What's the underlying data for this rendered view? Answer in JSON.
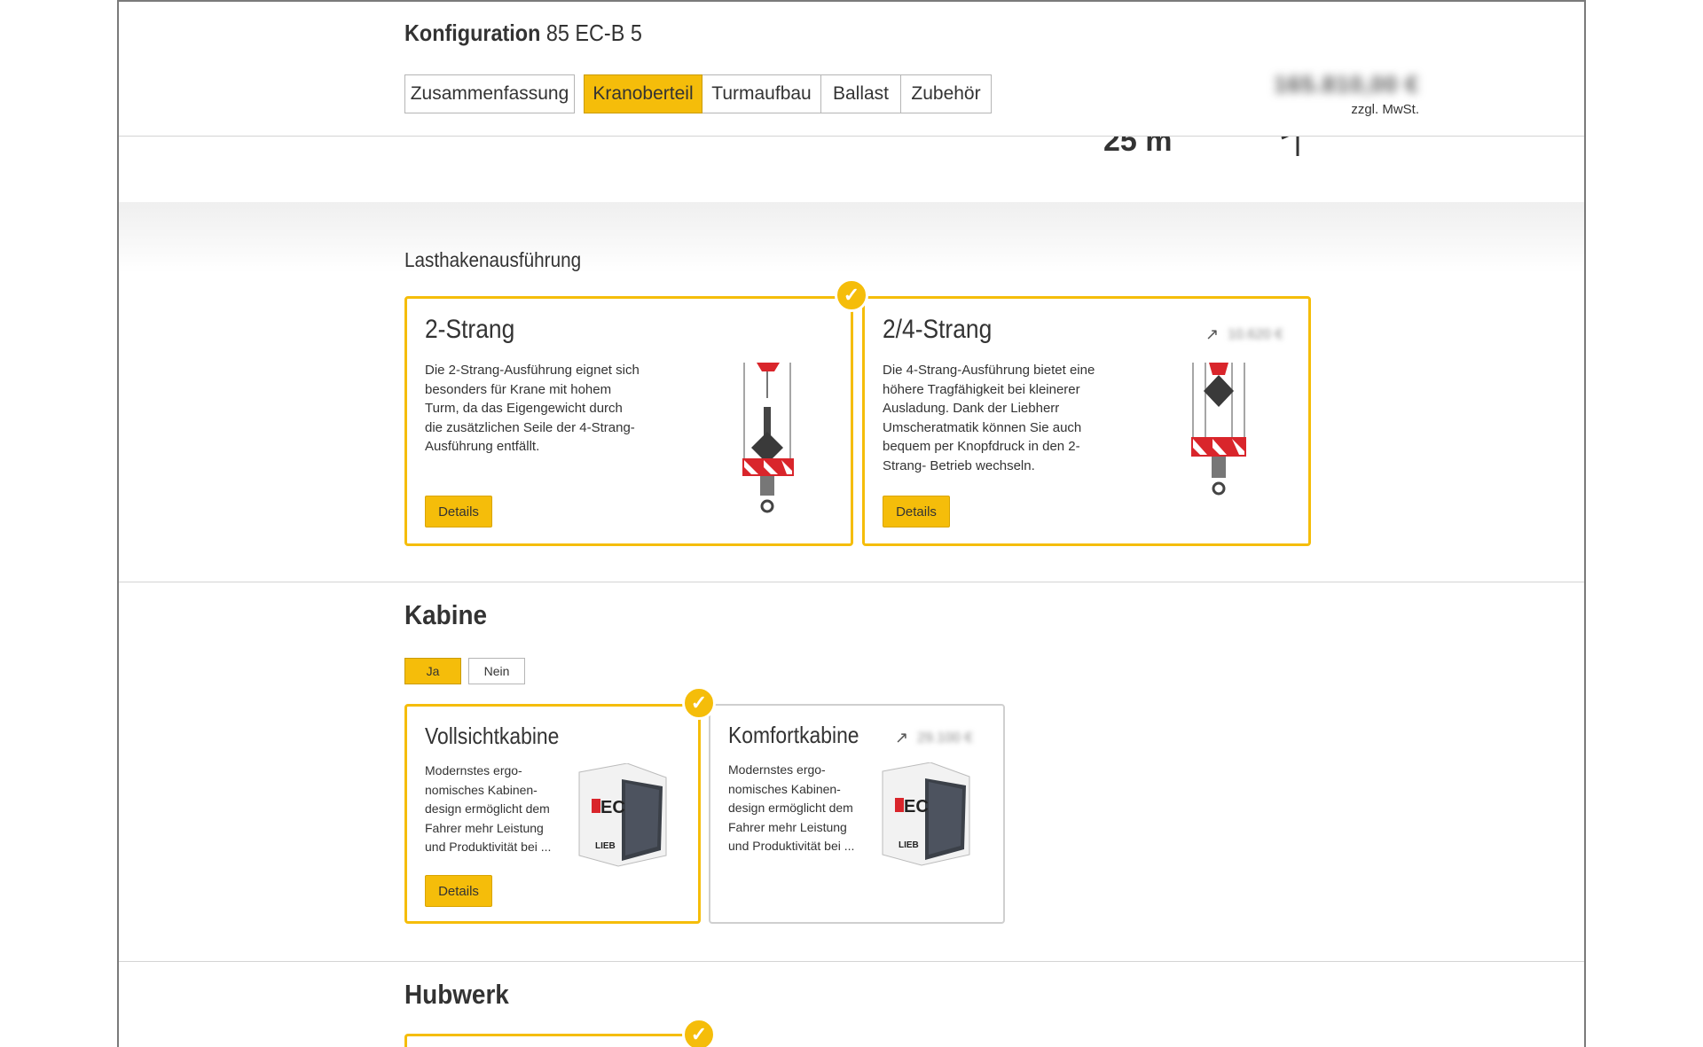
{
  "header": {
    "title_bold": "Konfiguration",
    "title_model": "85 EC-B 5",
    "tabs": [
      "Zusammenfassung",
      "Kranoberteil",
      "Turmaufbau",
      "Ballast",
      "Zubehör"
    ],
    "active_tab": "Kranoberteil",
    "price_blurred": "165.810,00 €",
    "vat_note": "zzgl. MwSt."
  },
  "ghost_number": "25 m",
  "lasthaken": {
    "heading": "Lasthakenausführung",
    "options": [
      {
        "title": "2-Strang",
        "desc": "Die 2-Strang-Ausführung eignet sich besonders für Krane mit hohem Turm, da das Eigengewicht durch die zusätzlichen Seile der 4-Strang-Ausführung entfällt.",
        "desc_lines": [
          "Die 2-Strang-Ausführung eignet sich",
          "besonders für Krane mit hohem",
          "Turm, da das Eigengewicht durch",
          "die zusätzlichen Seile der 4-Strang-",
          "Ausführung entfällt."
        ],
        "details_label": "Details",
        "selected": true,
        "image": "two-fall-hook-image"
      },
      {
        "title": "2/4-Strang",
        "price": "10.620 €",
        "desc_lines": [
          "Die 4-Strang-Ausführung bietet eine",
          "höhere Tragfähigkeit bei kleinerer",
          "Ausladung. Dank der Liebherr",
          "Umscheratmatik können Sie auch",
          "bequem per Knopfdruck in den 2-",
          "Strang- Betrieb wechseln."
        ],
        "details_label": "Details",
        "selected": false,
        "image": "four-fall-hook-image"
      }
    ]
  },
  "kabine": {
    "heading": "Kabine",
    "toggle": [
      "Ja",
      "Nein"
    ],
    "toggle_active": "Ja",
    "options": [
      {
        "title": "Vollsichtkabine",
        "desc_lines": [
          "Modernstes ergo-",
          "nomisches Kabinen-",
          "design ermöglicht dem",
          "Fahrer mehr Leistung",
          "und Produktivität bei ..."
        ],
        "details_label": "Details",
        "selected": true,
        "image": "cabin-image"
      },
      {
        "title": "Komfortkabine",
        "price": "29.100 €",
        "desc_lines": [
          "Modernstes ergo-",
          "nomisches Kabinen-",
          "design ermöglicht dem",
          "Fahrer mehr Leistung",
          "und Produktivität bei ..."
        ],
        "selected": false,
        "image": "cabin-image"
      }
    ]
  },
  "hubwerk": {
    "heading": "Hubwerk"
  },
  "colors": {
    "accent": "#f5bd0a",
    "text": "#333333",
    "border": "#d4d4d4"
  }
}
